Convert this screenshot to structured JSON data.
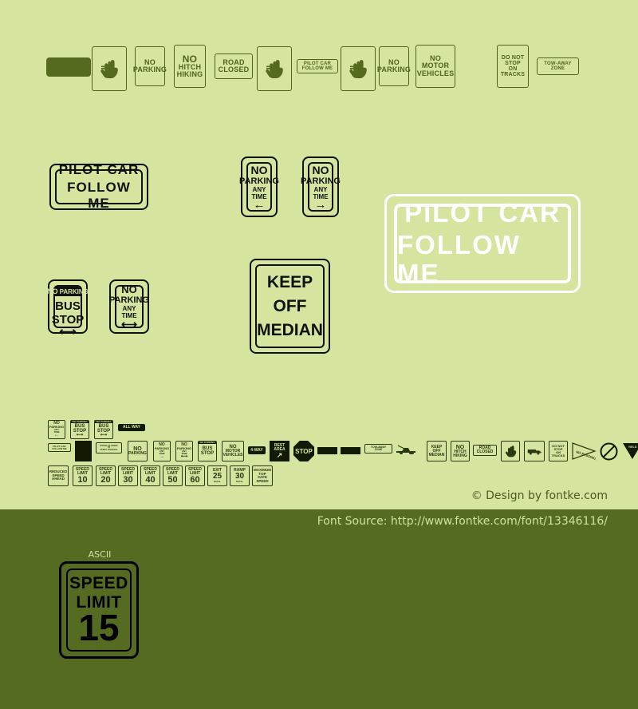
{
  "page": {
    "background_color": "#d5e5a0",
    "band_color": "#566b22",
    "ink_color": "#4e6320"
  },
  "top_row": [
    {
      "name": "solid-bar-glyph",
      "kind": "solid",
      "label": ""
    },
    {
      "name": "hand-glyph",
      "kind": "hand",
      "label": "hand-icon"
    },
    {
      "name": "no-parking-sign",
      "kind": "sign",
      "lines": [
        "NO",
        "PARKING"
      ]
    },
    {
      "name": "no-hitch-hiking-sign",
      "kind": "sign",
      "lines": [
        "NO",
        "HITCH",
        "HIKING"
      ]
    },
    {
      "name": "road-closed-sign",
      "kind": "sign",
      "lines": [
        "ROAD",
        "CLOSED"
      ]
    },
    {
      "name": "hand-glyph-2",
      "kind": "hand",
      "label": "hand-icon"
    },
    {
      "name": "pilot-car-follow-me-sign",
      "kind": "sign",
      "lines": [
        "PILOT CAR",
        "FOLLOW ME"
      ]
    },
    {
      "name": "hand-glyph-3",
      "kind": "hand",
      "label": "hand-icon"
    },
    {
      "name": "no-parking-sign-2",
      "kind": "sign",
      "lines": [
        "NO",
        "PARKING"
      ]
    },
    {
      "name": "no-motor-vehicles-sign",
      "kind": "sign",
      "lines": [
        "NO",
        "MOTOR",
        "VEHICLES"
      ]
    },
    {
      "name": "do-not-stop-on-tracks-sign",
      "kind": "sign",
      "lines": [
        "DO NOT",
        "STOP",
        "ON",
        "TRACKS"
      ]
    },
    {
      "name": "tow-away-zone-sign",
      "kind": "sign",
      "lines": [
        "TOW-AWAY",
        "ZONE"
      ]
    }
  ],
  "samples": {
    "pilot_car": {
      "line1": "PILOT CAR",
      "line2": "FOLLOW ME"
    },
    "no_parking_left": {
      "line1": "NO",
      "line2": "PARKING",
      "line3": "ANY",
      "line4": "TIME",
      "arrow": "←"
    },
    "no_parking_right": {
      "line1": "NO",
      "line2": "PARKING",
      "line3": "ANY",
      "line4": "TIME",
      "arrow": "→"
    },
    "pilot_car_white": {
      "line1": "PILOT CAR",
      "line2": "FOLLOW ME"
    },
    "bus_stop": {
      "header1": "NO",
      "header2": "PARKING",
      "line1": "BUS",
      "line2": "STOP",
      "arrow": "⟷"
    },
    "no_parking_any_time": {
      "line1": "NO",
      "line2": "PARKING",
      "line3": "ANY",
      "line4": "TIME",
      "arrow": "⟷"
    },
    "keep_off_median": {
      "line1": "KEEP",
      "line2": "OFF",
      "line3": "MEDIAN"
    }
  },
  "grid_row1": [
    {
      "name": "mini-no-parking-any-time",
      "lines": [
        "NO",
        "PARKING",
        "ANY",
        "TIME",
        "←"
      ]
    },
    {
      "name": "mini-no-parking-bus-stop",
      "header": [
        "NO",
        "PARKING"
      ],
      "lines": [
        "BUS",
        "STOP",
        "⟷"
      ]
    },
    {
      "name": "mini-no-parking-bus-stop-2",
      "header": [
        "NO",
        "PARKING"
      ],
      "lines": [
        "BUS",
        "STOP",
        "⟷"
      ]
    },
    {
      "name": "mini-all-way",
      "lines": [
        "ALL WAY"
      ],
      "inverted": true
    }
  ],
  "grid_row2": [
    {
      "name": "mini-pilot-car-follow-me",
      "lines": [
        "PILOT CAR",
        "FOLLOW ME"
      ]
    },
    {
      "name": "mini-solid-block",
      "kind": "solid"
    },
    {
      "name": "mini-road-closed-thru-traffic",
      "lines": [
        "ROAD CLOSED",
        "TO",
        "THRU TRAFFIC"
      ]
    },
    {
      "name": "mini-no-parking",
      "lines": [
        "NO",
        "PARKING"
      ]
    },
    {
      "name": "mini-no-parking-any-time-2",
      "lines": [
        "NO",
        "PARKING",
        "ANY",
        "TIME",
        "→"
      ]
    },
    {
      "name": "mini-no-parking-any-time-3",
      "lines": [
        "NO",
        "PARKING",
        "ANY",
        "TIME",
        "⟷"
      ]
    },
    {
      "name": "mini-bus-stop-2",
      "header": [
        "NO",
        "PARKING"
      ],
      "lines": [
        "BUS",
        "STOP"
      ]
    },
    {
      "name": "mini-no-motor-vehicles",
      "lines": [
        "NO",
        "MOTOR",
        "VEHICLES"
      ]
    },
    {
      "name": "mini-4-way",
      "lines": [
        "4-WAY"
      ],
      "inverted": true
    },
    {
      "name": "mini-rest-area",
      "lines": [
        "REST",
        "AREA",
        "↗"
      ],
      "inverted": true
    },
    {
      "name": "mini-stop-octagon",
      "lines": [
        "STOP"
      ],
      "kind": "octagon"
    },
    {
      "name": "mini-solid-block-2",
      "kind": "solid"
    },
    {
      "name": "mini-solid-block-3",
      "kind": "solid"
    },
    {
      "name": "mini-tow-away-zone",
      "lines": [
        "TOW-AWAY",
        "ZONE"
      ]
    },
    {
      "name": "mini-tow-truck-icon",
      "kind": "icon",
      "label": "tow-truck-icon"
    },
    {
      "name": "mini-keep-off-median",
      "lines": [
        "KEEP",
        "OFF",
        "MEDIAN"
      ]
    },
    {
      "name": "mini-no-hitch-hiking",
      "lines": [
        "NO",
        "HITCH",
        "HIKING"
      ]
    },
    {
      "name": "mini-road-closed",
      "lines": [
        "ROAD",
        "CLOSED"
      ]
    },
    {
      "name": "mini-hand-icon",
      "kind": "icon",
      "label": "hand-icon"
    },
    {
      "name": "mini-truck-icon",
      "kind": "icon",
      "label": "truck-icon"
    },
    {
      "name": "mini-do-not-stop-on-tracks",
      "lines": [
        "DO NOT",
        "STOP",
        "ON",
        "TRACKS"
      ]
    },
    {
      "name": "mini-no-passing-zone-pennant",
      "lines": [
        "NO PASSING ZONE"
      ],
      "kind": "pennant"
    },
    {
      "name": "mini-prohibition-circle",
      "kind": "circle",
      "label": "prohibition-icon"
    },
    {
      "name": "mini-yield-triangle",
      "lines": [
        "YIELD"
      ],
      "kind": "yield"
    }
  ],
  "grid_row3": [
    {
      "name": "mini-reduced-speed-ahead",
      "lines": [
        "REDUCED",
        "SPEED",
        "AHEAD"
      ]
    },
    {
      "name": "mini-speed-limit-10",
      "lines": [
        "SPEED",
        "LIMIT"
      ],
      "big": "10"
    },
    {
      "name": "mini-speed-limit-20",
      "lines": [
        "SPEED",
        "LIMIT"
      ],
      "big": "20"
    },
    {
      "name": "mini-speed-limit-30",
      "lines": [
        "SPEED",
        "LIMIT"
      ],
      "big": "30"
    },
    {
      "name": "mini-speed-limit-40",
      "lines": [
        "SPEED",
        "LIMIT"
      ],
      "big": "40"
    },
    {
      "name": "mini-speed-limit-50",
      "lines": [
        "SPEED",
        "LIMIT"
      ],
      "big": "50"
    },
    {
      "name": "mini-speed-limit-60",
      "lines": [
        "SPEED",
        "LIMIT"
      ],
      "big": "60"
    },
    {
      "name": "mini-exit-25-mph",
      "lines": [
        "EXIT"
      ],
      "big": "25",
      "sub": "M.P.H."
    },
    {
      "name": "mini-ramp-30-mph",
      "lines": [
        "RAMP"
      ],
      "big": "30",
      "sub": "M.P.H."
    },
    {
      "name": "mini-maximum-top-safe-speed",
      "lines": [
        "MAXIMUM",
        "TOP",
        "SAFE",
        "SPEED"
      ]
    }
  ],
  "footer": {
    "design_credit": "© Design by fontke.com",
    "font_source": "Font Source: http://www.fontke.com/font/13346116/"
  },
  "ascii_sample": {
    "label": "ASCII",
    "line1": "SPEED",
    "line2": "LIMIT",
    "number": "15"
  }
}
